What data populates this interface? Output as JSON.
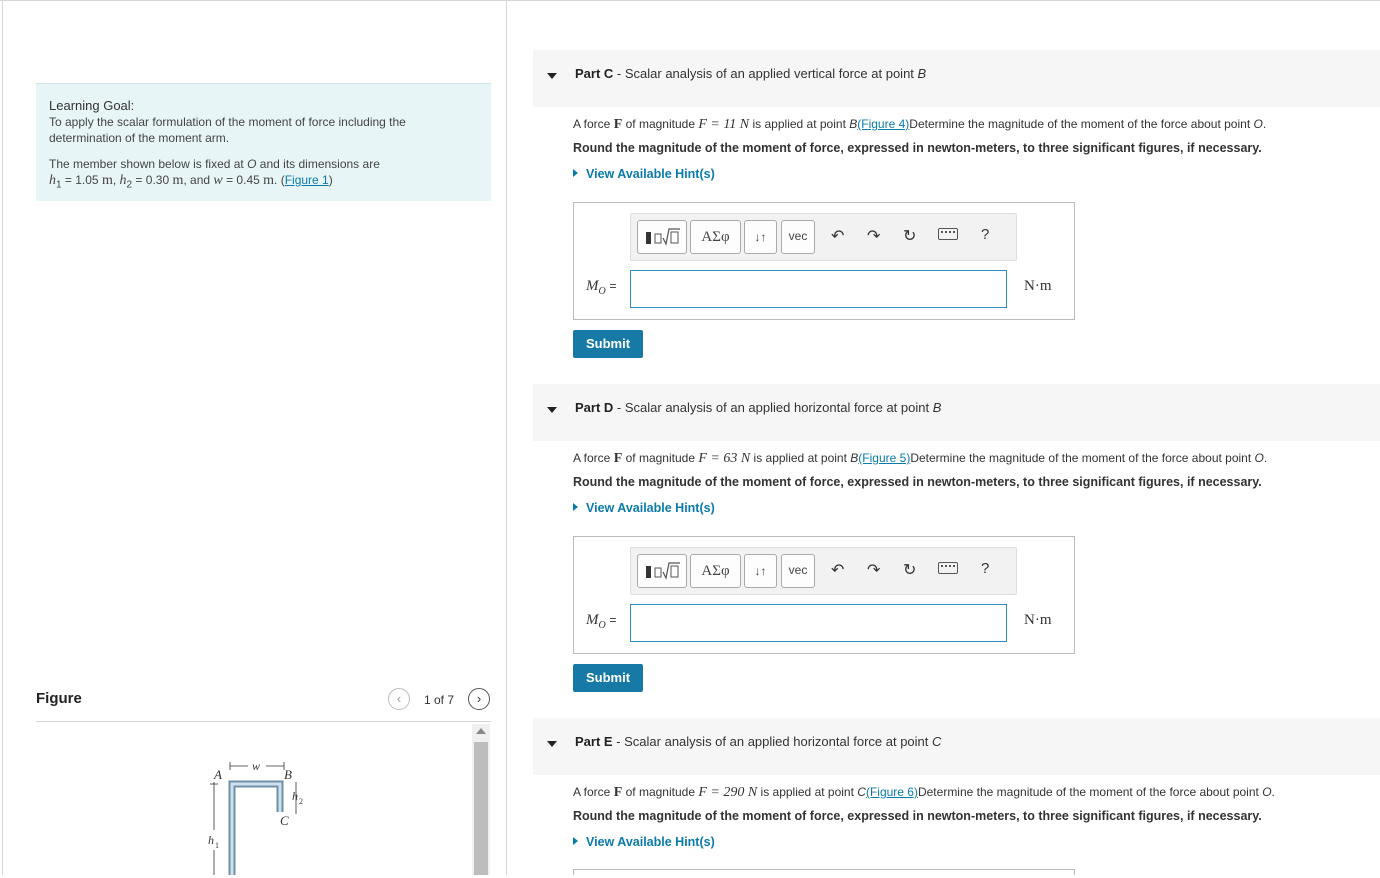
{
  "learning_goal": {
    "title": "Learning Goal:",
    "text": "To apply the scalar formulation of the moment of force including the determination of the moment arm.",
    "dims_prefix": "The member shown below is fixed at",
    "dims_point": "O",
    "dims_mid": "and its dimensions are",
    "h1": "h",
    "h1_sub": "1",
    "h1_val": "= 1.05",
    "h2": "h",
    "h2_sub": "2",
    "h2_val": "= 0.30",
    "and": ", and",
    "w": "w",
    "w_val": "= 0.45",
    "unit_m": "m",
    "figure_link": "Figure 1"
  },
  "figure_panel": {
    "title": "Figure",
    "count": "1 of 7",
    "prev_icon": "chevron-left-icon",
    "next_icon": "chevron-right-icon",
    "labels": {
      "A": "A",
      "B": "B",
      "C": "C",
      "w": "w",
      "h1": "h",
      "h1_sub": "1",
      "h2": "h",
      "h2_sub": "2"
    }
  },
  "parts": [
    {
      "label": "Part C",
      "title": "Scalar analysis of an applied vertical force at point",
      "point": "B",
      "statement_pre": "A force",
      "force_symbol": "F",
      "statement_mid": "of magnitude",
      "magnitude": "F = 11 N",
      "statement_post": "is applied at point",
      "apply_point": "B",
      "figure_link": "(Figure 4)",
      "statement_end": "Determine the magnitude of the moment of the force about point",
      "about_point": "O",
      "round_text": "Round the magnitude of the moment of force, expressed in newton-meters, to three significant figures, if necessary.",
      "hint": "View Available Hint(s)",
      "eq_var": "M",
      "eq_sub": "O",
      "units": "N·m",
      "submit": "Submit"
    },
    {
      "label": "Part D",
      "title": "Scalar analysis of an applied horizontal force at point",
      "point": "B",
      "statement_pre": "A force",
      "force_symbol": "F",
      "statement_mid": "of magnitude",
      "magnitude": "F = 63 N",
      "statement_post": "is applied at point",
      "apply_point": "B",
      "figure_link": "(Figure 5)",
      "statement_end": "Determine the magnitude of the moment of the force about point",
      "about_point": "O",
      "round_text": "Round the magnitude of the moment of force, expressed in newton-meters, to three significant figures, if necessary.",
      "hint": "View Available Hint(s)",
      "eq_var": "M",
      "eq_sub": "O",
      "units": "N·m",
      "submit": "Submit"
    },
    {
      "label": "Part E",
      "title": "Scalar analysis of an applied horizontal force at point",
      "point": "C",
      "statement_pre": "A force",
      "force_symbol": "F",
      "statement_mid": "of magnitude",
      "magnitude": "F = 290 N",
      "statement_post": "is applied at point",
      "apply_point": "C",
      "figure_link": "(Figure 6)",
      "statement_end": "Determine the magnitude of the moment of the force about point",
      "about_point": "O",
      "round_text": "Round the magnitude of the moment of force, expressed in newton-meters, to three significant figures, if necessary.",
      "hint": "View Available Hint(s)"
    }
  ],
  "toolbar": {
    "templates_icon": "templates-radical-icon",
    "greek": "ΑΣφ",
    "arrows": "↓↑",
    "vec": "vec",
    "undo_icon": "undo-icon",
    "redo_icon": "redo-icon",
    "reset_icon": "reset-icon",
    "keyboard_icon": "keyboard-icon",
    "help": "?"
  },
  "colors": {
    "accent": "#177aa6",
    "link": "#0a7bab",
    "goal_bg": "#e8f5f7",
    "input_border": "#2d8ec0"
  }
}
